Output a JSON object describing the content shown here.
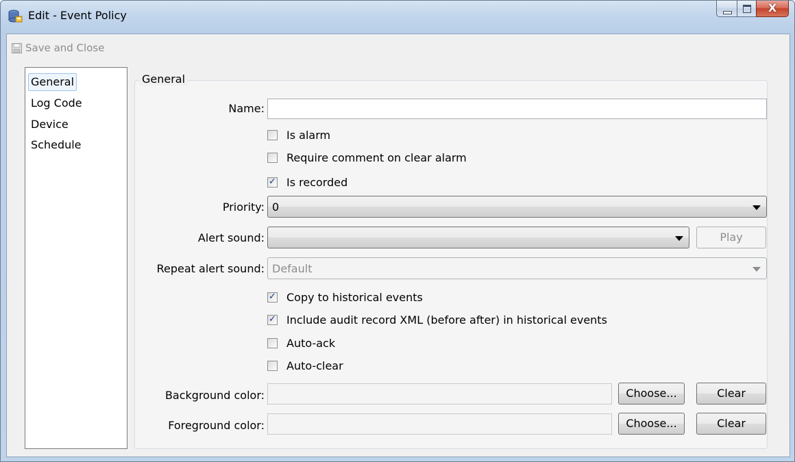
{
  "window": {
    "title": "Edit - Event Policy",
    "app_icon": "database-icon",
    "close_glyph": "X"
  },
  "toolbar": {
    "save_close_label": "Save and Close",
    "save_close_icon": "floppy-disk-icon"
  },
  "nav": {
    "items": [
      {
        "label": "General",
        "selected": true
      },
      {
        "label": "Log Code",
        "selected": false
      },
      {
        "label": "Device",
        "selected": false
      },
      {
        "label": "Schedule",
        "selected": false
      }
    ]
  },
  "general": {
    "group_title": "General",
    "name_label": "Name:",
    "name_value": "",
    "is_alarm_label": "Is alarm",
    "is_alarm_checked": false,
    "require_comment_label": "Require comment on clear alarm",
    "require_comment_checked": false,
    "is_recorded_label": "Is recorded",
    "is_recorded_checked": true,
    "priority_label": "Priority:",
    "priority_value": "0",
    "alert_sound_label": "Alert sound:",
    "alert_sound_value": "",
    "play_label": "Play",
    "repeat_label": "Repeat alert sound:",
    "repeat_value": "Default",
    "copy_hist_label": "Copy to historical events",
    "copy_hist_checked": true,
    "include_audit_label": "Include audit record XML (before  after) in historical events",
    "include_audit_checked": true,
    "auto_ack_label": "Auto-ack",
    "auto_ack_checked": false,
    "auto_clear_label": "Auto-clear",
    "auto_clear_checked": false,
    "bg_color_label": "Background color:",
    "fg_color_label": "Foreground color:",
    "choose_label": "Choose...",
    "clear_label": "Clear",
    "check_glyph": "✓"
  }
}
